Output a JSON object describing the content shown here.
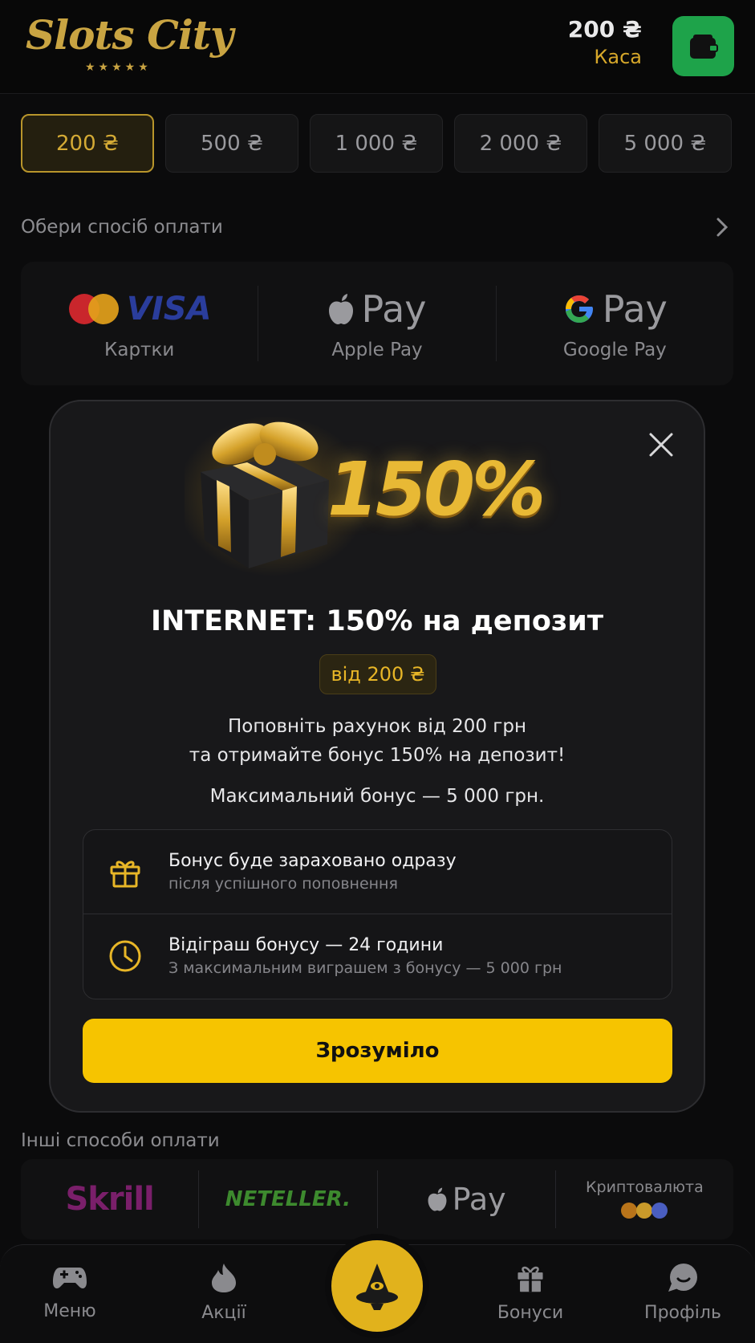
{
  "header": {
    "logo_text": "Slots City",
    "logo_stars": "★★★★★",
    "balance_amount": "200 ₴",
    "balance_label": "Каса"
  },
  "amounts": [
    "200 ₴",
    "500 ₴",
    "1 000 ₴",
    "2 000 ₴",
    "5 000 ₴"
  ],
  "payment": {
    "title": "Обери спосіб оплати",
    "methods": [
      {
        "label": "Картки",
        "logo": "VISA"
      },
      {
        "label": "Apple Pay",
        "logo": "Pay"
      },
      {
        "label": "Google Pay",
        "logo": "Pay"
      }
    ]
  },
  "modal": {
    "title": "INTERNET: 150% на депозит",
    "badge": "від 200 ₴",
    "promo_percent": "150%",
    "desc_line1": "Поповніть рахунок від 200 грн",
    "desc_line2": "та отримайте бонус 150% на депозит!",
    "desc_line3": "Максимальний бонус — 5 000 грн.",
    "info": [
      {
        "icon": "gift-icon",
        "title": "Бонус буде зараховано одразу",
        "sub": "після успішного поповнення"
      },
      {
        "icon": "clock-icon",
        "title": "Відіграш бонусу — 24 години",
        "sub": "З максимальним виграшем з бонусу — 5 000 грн"
      }
    ],
    "cta": "Зрозуміло"
  },
  "other": {
    "title": "Інші способи оплати",
    "methods": [
      "Skrill",
      "NETELLER.",
      "Pay",
      "Криптовалюта"
    ]
  },
  "nav": {
    "items": [
      {
        "label": "Меню",
        "icon": "gamepad-icon"
      },
      {
        "label": "Акції",
        "icon": "flame-icon"
      },
      {
        "label": "Бонуси",
        "icon": "gift-icon"
      },
      {
        "label": "Профіль",
        "icon": "chat-icon"
      }
    ]
  },
  "colors": {
    "accent": "#f6c400",
    "gold": "#d4aa35",
    "wallet": "#1ea34a"
  }
}
